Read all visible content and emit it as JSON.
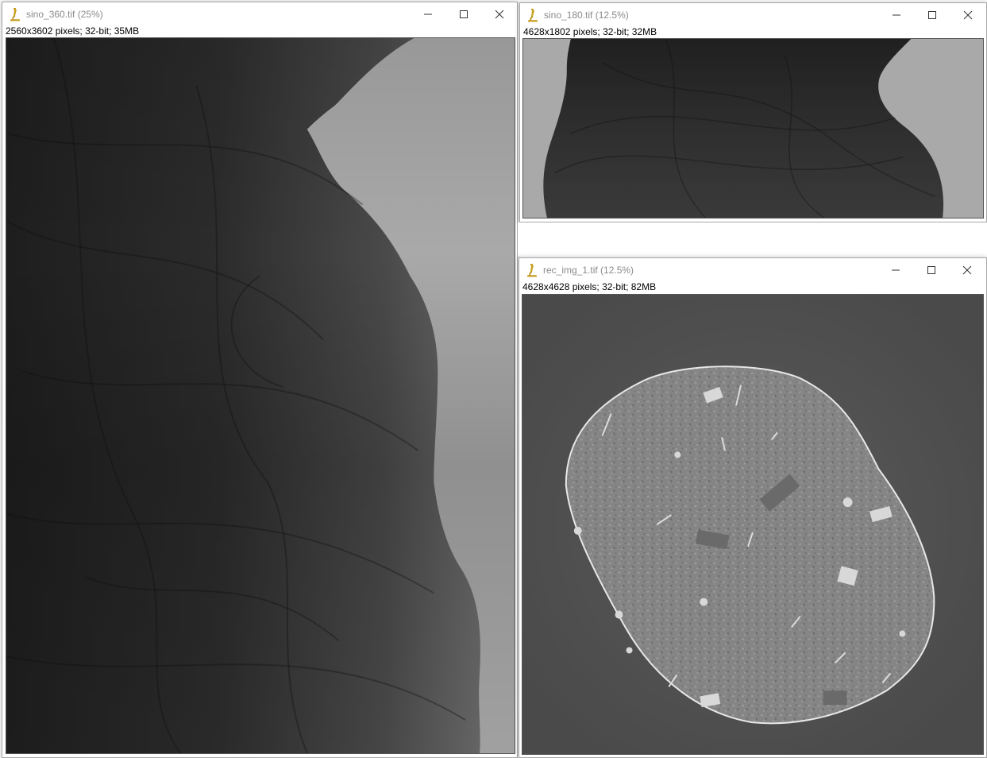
{
  "windows": [
    {
      "id": "sino360",
      "title": "sino_360.tif (25%)",
      "info": "2560x3602 pixels; 32-bit; 35MB",
      "buttons": {
        "minimize": "minimize-icon",
        "maximize": "maximize-icon",
        "close": "close-icon"
      }
    },
    {
      "id": "sino180",
      "title": "sino_180.tif (12.5%)",
      "info": "4628x1802 pixels; 32-bit; 32MB",
      "buttons": {
        "minimize": "minimize-icon",
        "maximize": "maximize-icon",
        "close": "close-icon"
      }
    },
    {
      "id": "recimg",
      "title": "rec_img_1.tif (12.5%)",
      "info": "4628x4628 pixels; 32-bit; 82MB",
      "buttons": {
        "minimize": "minimize-icon",
        "maximize": "maximize-icon",
        "close": "close-icon"
      }
    }
  ],
  "colors": {
    "title_text": "#8a8a8a",
    "info_text": "#000000",
    "sinogram_background": "#a9a9a9",
    "sinogram_dark": "#2a2a2a",
    "reconstruction_background": "#4f4f4f",
    "reconstruction_sample": "#858585",
    "app_icon": "#c8a020"
  },
  "icons": [
    "microscope-icon",
    "minimize-icon",
    "maximize-icon",
    "close-icon"
  ]
}
